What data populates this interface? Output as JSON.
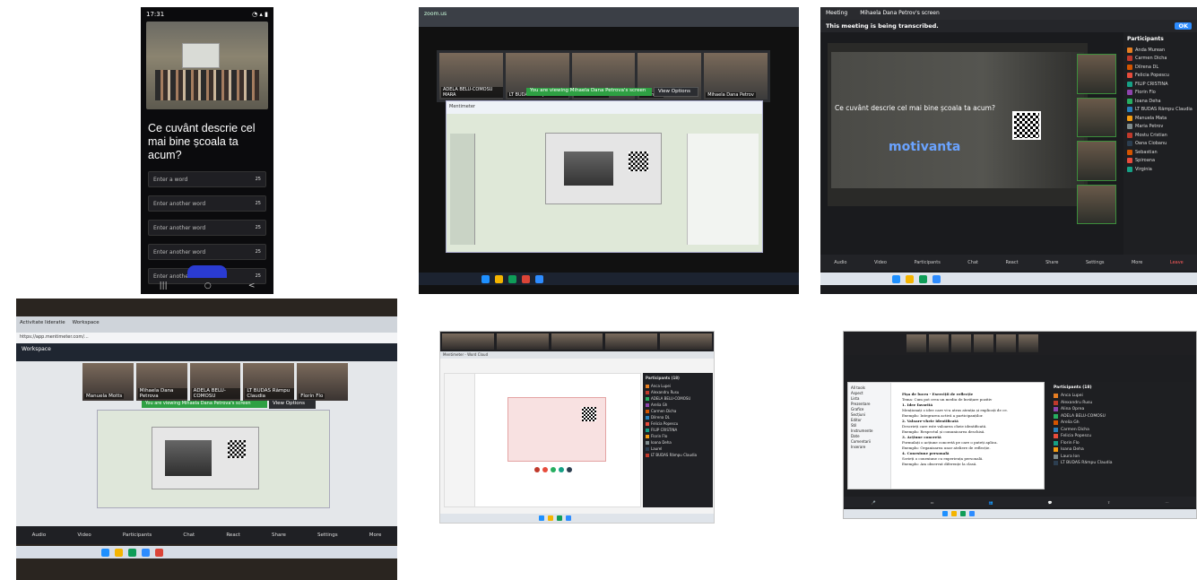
{
  "tile_phone": {
    "status_time": "17:31",
    "question": "Ce cuvânt descrie cel mai bine școala ta acum?",
    "inputs": [
      {
        "placeholder": "Enter a word",
        "count": "25"
      },
      {
        "placeholder": "Enter another word",
        "count": "25"
      },
      {
        "placeholder": "Enter another word",
        "count": "25"
      },
      {
        "placeholder": "Enter another word",
        "count": "25"
      },
      {
        "placeholder": "Enter another word",
        "count": "25"
      }
    ],
    "nav": [
      "|||",
      "○",
      "<"
    ]
  },
  "tile_laptop_share": {
    "participants": [
      "ADELA BELU-COMOSU MARA",
      "LT BUDAS Rămpu Claudia",
      "Mihaela Motts",
      "Florin Flo",
      "Mihaela Dana Petrov"
    ],
    "sharing_banner": "You are viewing Mihaela Dana Petrova's screen",
    "view_options": "View Options"
  },
  "tile_zoom_transcript": {
    "top": [
      "Meeting",
      "Mihaela Dana Petrov's screen"
    ],
    "transcript_notice": "This meeting is being transcribed.",
    "ok_label": "OK",
    "slide_question": "Ce cuvânt descrie cel mai bine școala ta acum?",
    "highlight_word": "motivanta",
    "participants_title": "Participants",
    "participants": [
      "Anda Murean",
      "Carmen Dicha",
      "Dilrena DL",
      "Felicia Popescu",
      "FILIP CRISTINA",
      "Florin Flo",
      "Ioana Deha",
      "LT BUDAS Rămpu Claudia",
      "Manuela Mata",
      "Maria Petrov",
      "Mostu Cristian",
      "Oana Ciobanu",
      "Sebastian",
      "Spiroana",
      "Virginia"
    ],
    "toolbar": [
      "Audio",
      "Video",
      "Participants",
      "Chat",
      "React",
      "Share",
      "Settings",
      "More",
      "Leave"
    ]
  },
  "tile_workspace": {
    "tabs": [
      "Activitate lideratie",
      "Workspace"
    ],
    "url": "https://app.mentimeter.com/...",
    "workspace": "Workspace",
    "participants": [
      "Manuela Motts",
      "Mihaela Dana Petrova",
      "ADELA BELU-COMOSU",
      "LT BUDAS Rămpu Claudia",
      "Florin Flo"
    ],
    "sharing_banner": "You are viewing Mihaela Dana Petrova's screen",
    "view_options": "View Options",
    "toolbar": [
      "Audio",
      "Video",
      "Participants",
      "Chat",
      "React",
      "Share",
      "Settings",
      "More"
    ]
  },
  "tile_menti_editor": {
    "tabs": "Mentimeter - Word Cloud",
    "participants_title": "Participants (18)",
    "participants": [
      "Anca Lupei",
      "Alexandru Rusu",
      "ADELA BELU-COMOSU",
      "Arelia Gh",
      "Carmen Dicha",
      "Dilrena DL",
      "Felicia Popescu",
      "FILIP CRISTINA",
      "Florin Flo",
      "Ioana Deha",
      "Laurel",
      "LT BUDAS Rămpu Claudia"
    ]
  },
  "tile_document": {
    "doc_title": "Fișa de lucru - Exerciții de reflecție",
    "headings": [
      "1. Idee favorită",
      "2. Valoare-cheie identificată",
      "3. Acțiune concretă",
      "4. Conexiune personală"
    ],
    "body_lines": [
      "Tema: Cum pot crea un mediu de învățare pozitiv",
      "Menționați o idee care vi-a atras atenția și explicați de ce.",
      "Exemplu: Integrarea activă a participanților.",
      "Descrieți care este valoarea cheie identificată.",
      "Exemplu: Respectul și comunicarea deschisă.",
      "Formulați o acțiune concretă pe care o puteți aplica.",
      "Exemplu: Organizarea unor ateliere de reflecție.",
      "Scrieți o conexiune cu experiența personală.",
      "Exemplu: Am observat diferențe la clasă."
    ],
    "left_items": [
      "All tools",
      "Aspect",
      "Lista",
      "Prezentare",
      "Grafice",
      "Secțiuni",
      "Editor",
      "Stil",
      "Instrumente",
      "Date",
      "Comentarii",
      "Inserare"
    ],
    "participants_title": "Participants (18)",
    "participants": [
      "Anca Lupei",
      "Alexandru Rusu",
      "Alina Oprea",
      "ADELA BELU-COMOSU",
      "Arelia Gh",
      "Carmen Dicha",
      "Felicia Popescu",
      "Florin Flo",
      "Ioana Deha",
      "Laura Ion",
      "LT BUDAS Rămpu Claudia"
    ]
  },
  "colors": {
    "accent_blue": "#2d8cff",
    "share_green": "#2ea043",
    "word_blue": "#6aa3ff"
  }
}
